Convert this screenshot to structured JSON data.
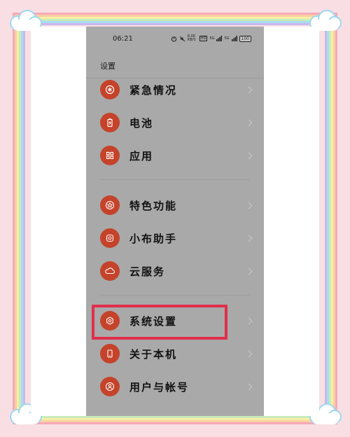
{
  "status_bar": {
    "time": "06:21",
    "net_speed": "8.00 KB/S",
    "signal_label_1": "5G",
    "signal_label_2": "5G",
    "hd_label": "HD",
    "battery": "100"
  },
  "header": {
    "title": "设置"
  },
  "settings": {
    "items": [
      {
        "label": "紧急情况",
        "icon": "asterisk-icon"
      },
      {
        "label": "电池",
        "icon": "battery-icon"
      },
      {
        "label": "应用",
        "icon": "grid-icon"
      },
      {
        "label": "特色功能",
        "icon": "star-icon"
      },
      {
        "label": "小布助手",
        "icon": "assistant-icon"
      },
      {
        "label": "云服务",
        "icon": "cloud-icon"
      },
      {
        "label": "系统设置",
        "icon": "gear-icon"
      },
      {
        "label": "关于本机",
        "icon": "phone-icon"
      },
      {
        "label": "用户与帐号",
        "icon": "user-icon"
      }
    ]
  },
  "colors": {
    "icon_bg": "#c4432a",
    "highlight": "#e02f4a",
    "screen_bg": "#a9a9a9"
  }
}
